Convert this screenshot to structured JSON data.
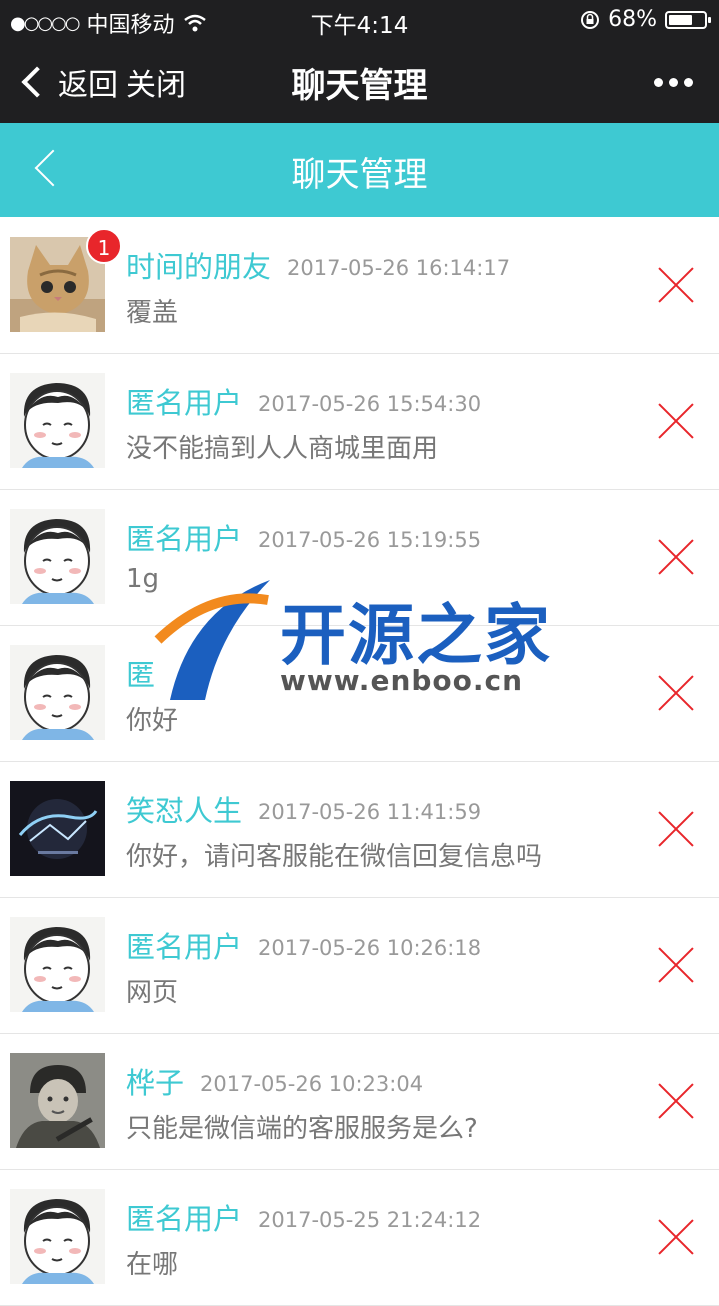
{
  "status_bar": {
    "signal": "●○○○○",
    "carrier": "中国移动",
    "time": "下午4:14",
    "battery": "68%",
    "battery_level": 0.68
  },
  "wechat_bar": {
    "back_label": "返回",
    "close_label": "关闭",
    "title": "聊天管理"
  },
  "header": {
    "title": "聊天管理"
  },
  "chats": [
    {
      "name": "时间的朋友",
      "time": "2017-05-26 16:14:17",
      "message": "覆盖",
      "badge": "1",
      "avatar": "cat"
    },
    {
      "name": "匿名用户",
      "time": "2017-05-26 15:54:30",
      "message": "没不能搞到人人商城里面用",
      "avatar": "cartoon-boy"
    },
    {
      "name": "匿名用户",
      "time": "2017-05-26 15:19:55",
      "message": "1g",
      "avatar": "cartoon-boy"
    },
    {
      "name": "匿",
      "time": "",
      "message": "你好",
      "avatar": "cartoon-boy"
    },
    {
      "name": "笑怼人生",
      "time": "2017-05-26 11:41:59",
      "message": "你好，请问客服能在微信回复信息吗",
      "avatar": "game-logo"
    },
    {
      "name": "匿名用户",
      "time": "2017-05-26 10:26:18",
      "message": "网页",
      "avatar": "cartoon-boy"
    },
    {
      "name": "桦子",
      "time": "2017-05-26 10:23:04",
      "message": "只能是微信端的客服服务是么?",
      "avatar": "soldier-photo"
    },
    {
      "name": "匿名用户",
      "time": "2017-05-25 21:24:12",
      "message": "在哪",
      "avatar": "cartoon-boy"
    }
  ],
  "watermark": {
    "text": "开源之家",
    "url": "www.enboo.cn"
  },
  "colors": {
    "accent": "#3ec9d2",
    "delete": "#e8262b",
    "topbar": "#1f1f21"
  }
}
